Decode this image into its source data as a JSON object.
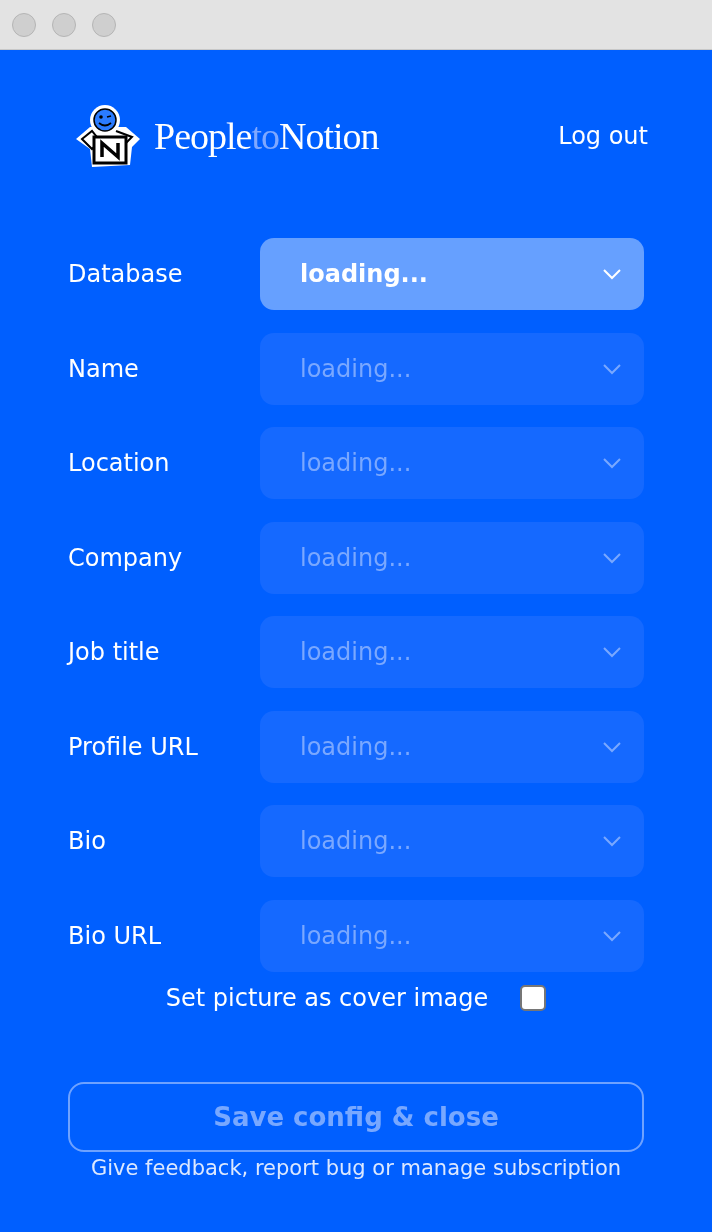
{
  "header": {
    "logo_parts": [
      {
        "text": "People",
        "highlight": false
      },
      {
        "text": "to",
        "highlight": true
      },
      {
        "text": "Notion",
        "highlight": false
      }
    ],
    "logout": "Log out"
  },
  "fields": [
    {
      "label": "Database",
      "value": "loading...",
      "disabled": false
    },
    {
      "label": "Name",
      "value": "loading...",
      "disabled": true
    },
    {
      "label": "Location",
      "value": "loading...",
      "disabled": true
    },
    {
      "label": "Company",
      "value": "loading...",
      "disabled": true
    },
    {
      "label": "Job title",
      "value": "loading...",
      "disabled": true
    },
    {
      "label": "Profile URL",
      "value": "loading...",
      "disabled": true
    },
    {
      "label": "Bio",
      "value": "loading...",
      "disabled": true
    },
    {
      "label": "Bio URL",
      "value": "loading...",
      "disabled": true
    }
  ],
  "cover_option": {
    "label": "Set picture as cover image",
    "checked": false
  },
  "save_button": {
    "label": "Save config & close",
    "disabled": true
  },
  "footer_link": "Give feedback, report bug or manage subscription"
}
